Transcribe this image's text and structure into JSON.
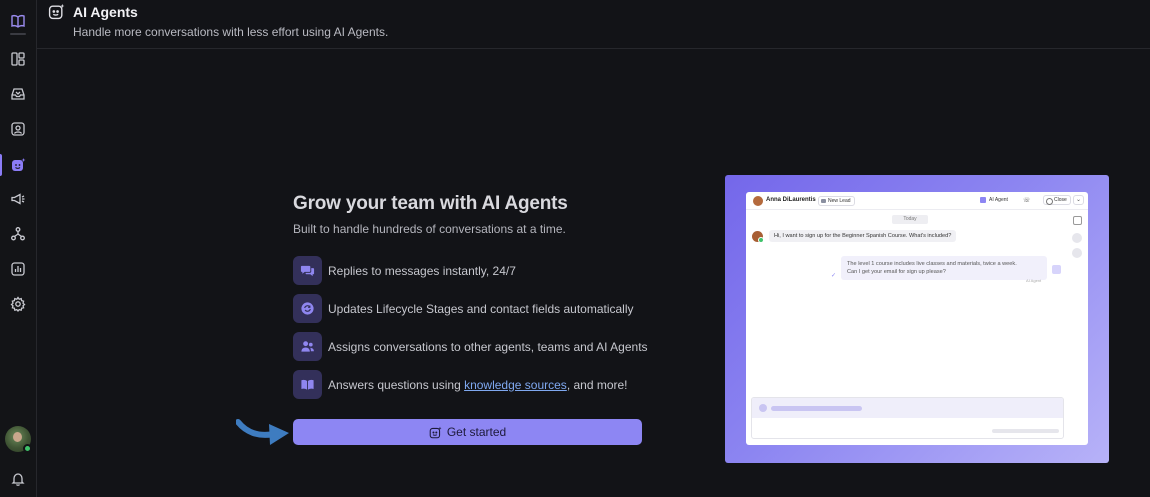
{
  "sidebar": {
    "items": [
      {
        "icon": "book-open-icon"
      },
      {
        "icon": "layout-panels-icon"
      },
      {
        "icon": "inbox-icon"
      },
      {
        "icon": "contact-icon"
      },
      {
        "icon": "ai-agent-icon",
        "active": true
      },
      {
        "icon": "megaphone-icon"
      },
      {
        "icon": "workflow-icon"
      },
      {
        "icon": "reports-icon"
      },
      {
        "icon": "settings-icon"
      }
    ],
    "bottom": [
      {
        "icon": "avatar"
      },
      {
        "icon": "bell-icon"
      }
    ]
  },
  "header": {
    "title": "AI Agents",
    "subtitle": "Handle more conversations with less effort using AI Agents.",
    "icon": "ai-agent-icon"
  },
  "main": {
    "headline": "Grow your team with AI Agents",
    "subline": "Built to handle hundreds of conversations at a time.",
    "features": [
      {
        "icon": "chat-bubbles-icon",
        "text": "Replies to messages instantly, 24/7"
      },
      {
        "icon": "refresh-icon",
        "text": "Updates Lifecycle Stages and contact fields automatically"
      },
      {
        "icon": "users-icon",
        "text": "Assigns conversations to other agents, teams and AI Agents"
      },
      {
        "icon": "book-icon",
        "text_before": "Answers questions using ",
        "link": "knowledge sources",
        "text_after": ", and more!"
      }
    ],
    "cta_label": "Get started"
  },
  "preview": {
    "contact_name": "Anna DiLaurentis",
    "lead_badge": "New Lead",
    "ai_agent_label": "AI Agent",
    "close_label": "Close",
    "date_divider": "Today",
    "incoming_message": "Hi, I want to sign up for the Beginner Spanish Course. What's included?",
    "outgoing_line1": "The level 1 course includes live classes and materials, twice a week.",
    "outgoing_line2": "Can I get your email for sign up please?",
    "outgoing_sender": "AI Agent"
  },
  "colors": {
    "accent": "#8d86f3",
    "background": "#121317",
    "feature_icon_bg": "#33305a",
    "arrow": "#4a86c8"
  }
}
